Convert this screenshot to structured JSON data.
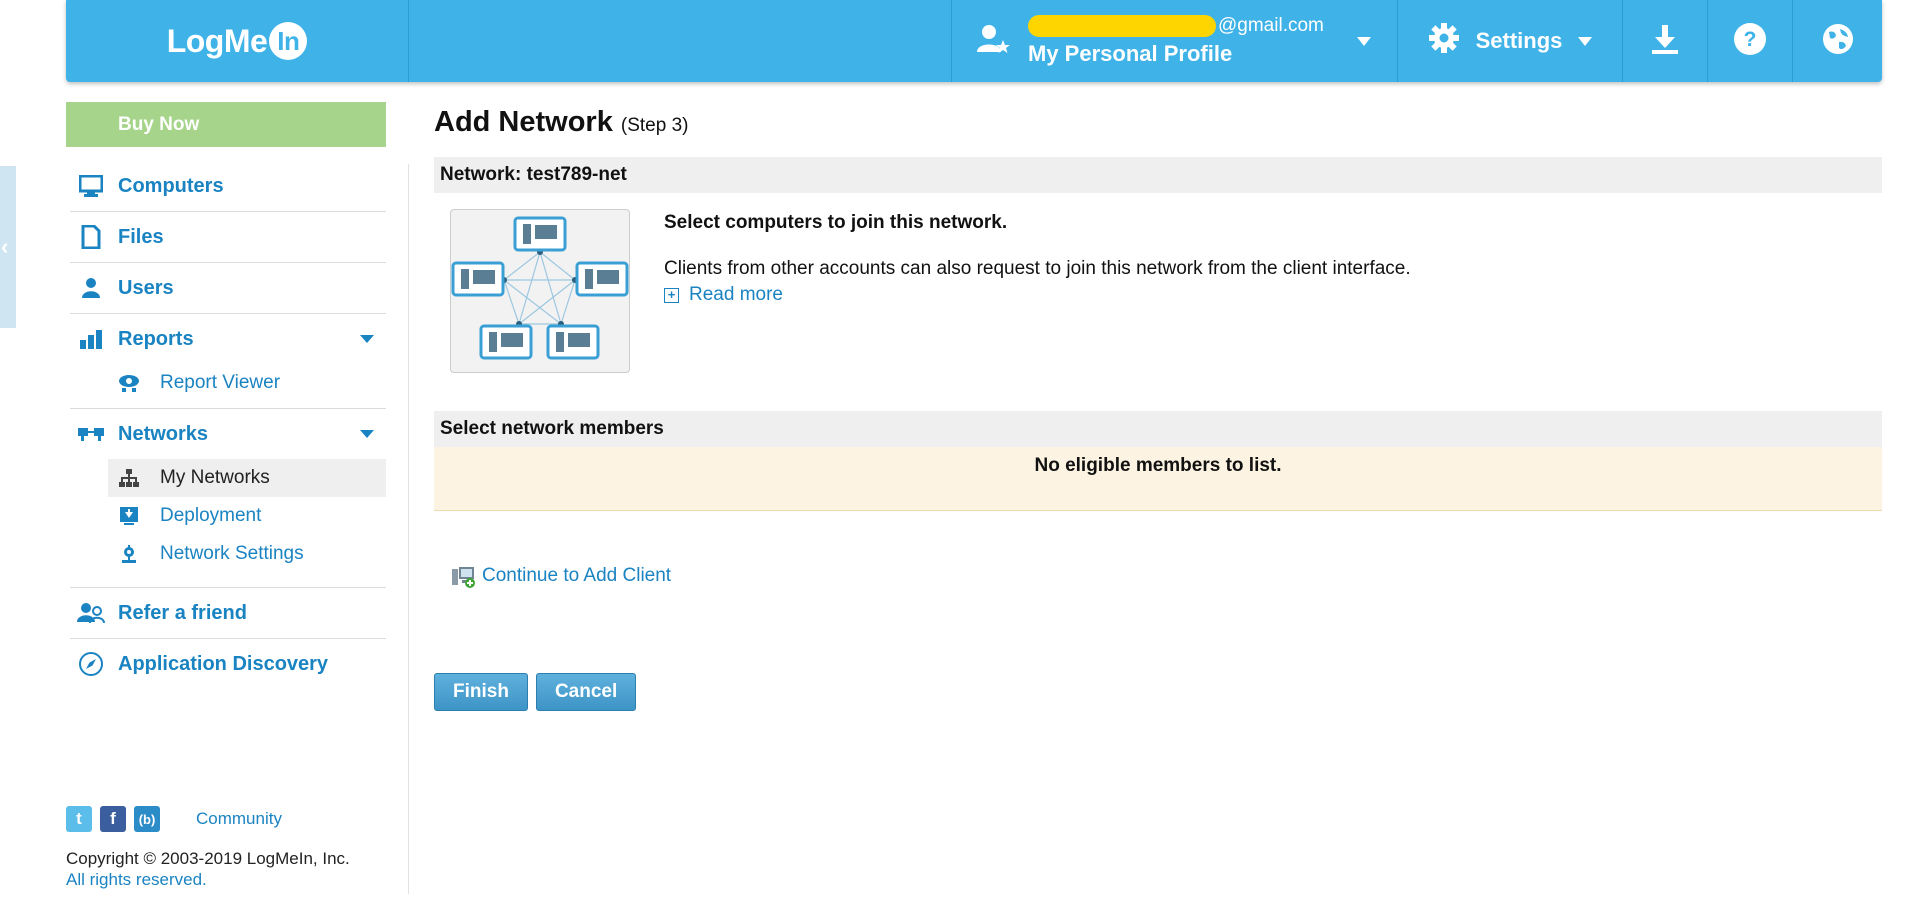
{
  "header": {
    "logo_text": "LogMe",
    "logo_in": "In",
    "email_visible": "@gmail.com",
    "profile_name": "My Personal Profile",
    "settings_label": "Settings"
  },
  "sidebar": {
    "buy_now": "Buy Now",
    "items": [
      {
        "label": "Computers"
      },
      {
        "label": "Files"
      },
      {
        "label": "Users"
      },
      {
        "label": "Reports"
      },
      {
        "label": "Report Viewer"
      },
      {
        "label": "Networks"
      },
      {
        "label": "My Networks"
      },
      {
        "label": "Deployment"
      },
      {
        "label": "Network Settings"
      },
      {
        "label": "Refer a friend"
      },
      {
        "label": "Application Discovery"
      }
    ],
    "side_tab": "‹"
  },
  "footer": {
    "community": "Community",
    "copyright": "Copyright © 2003-2019 LogMeIn, Inc.",
    "rights": "All rights reserved."
  },
  "main": {
    "title": "Add Network",
    "step": "(Step 3)",
    "network_label": "Network: test789-net",
    "select_heading": "Select computers to join this network.",
    "description": "Clients from other accounts can also request to join this network from the client interface.",
    "read_more": "Read more",
    "members_header": "Select network members",
    "no_members": "No eligible members to list.",
    "continue_link": "Continue to Add Client",
    "finish": "Finish",
    "cancel": "Cancel"
  },
  "colors": {
    "header_bg": "#3fb3e8",
    "link": "#1a83c2",
    "buy_now": "#a5d48a",
    "empty_bg": "#fdf3e2"
  }
}
